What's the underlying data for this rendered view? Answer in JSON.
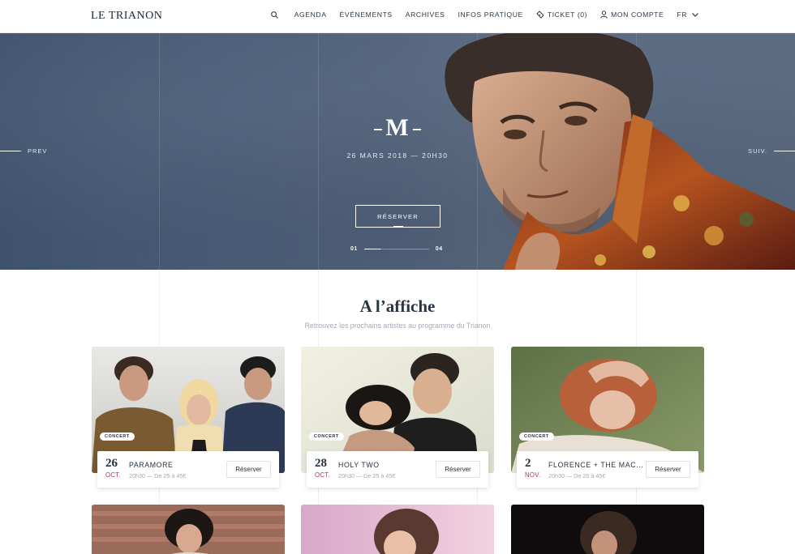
{
  "header": {
    "logo": "LE TRIANON",
    "nav": {
      "agenda": "AGENDA",
      "evenements": "ÉVÉNEMENTS",
      "archives": "ARCHIVES",
      "infos": "INFOS PRATIQUE",
      "ticket": "TICKET (0)",
      "account": "MON COMPTE",
      "lang": "FR"
    }
  },
  "hero": {
    "title": "M",
    "date": "26 MARS 2018 — 20H30",
    "button": "RÉSERVER",
    "prev": "PREV",
    "next": "SUIV.",
    "pager_current": "01",
    "pager_total": "04",
    "pager_progress": 0.25
  },
  "section": {
    "title": "A l’affiche",
    "subtitle": "Retrouvez les prochains artistes au programme du Trianon"
  },
  "events": [
    {
      "tag": "CONCERT",
      "day": "26",
      "month": "OCT.",
      "name": "PARAMORE",
      "meta": "20h30 — De 25 à 45€",
      "button": "Réserver"
    },
    {
      "tag": "CONCERT",
      "day": "28",
      "month": "OCT.",
      "name": "HOLY TWO",
      "meta": "20h30 — De 25 à 45€",
      "button": "Réserver"
    },
    {
      "tag": "CONCERT",
      "day": "2",
      "month": "NOV.",
      "name": "FLORENCE + THE MAC...",
      "meta": "20h30 — De 25 à 45€",
      "button": "Réserver"
    }
  ],
  "colors": {
    "hero_bg": "#4a5c77",
    "accent_month": "#b8304a",
    "text_dark": "#23303f",
    "text_muted": "#a3aab3"
  }
}
